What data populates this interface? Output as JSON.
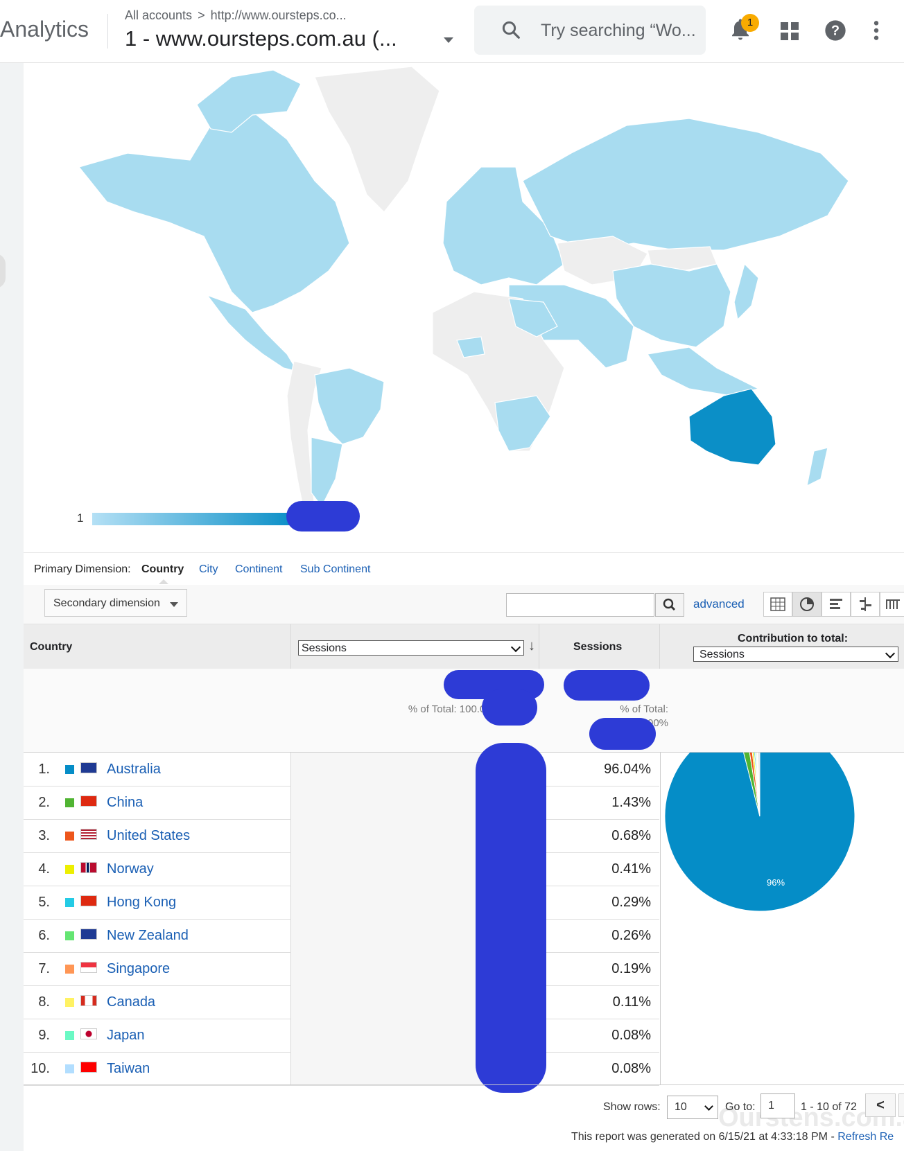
{
  "header": {
    "app_name": "Analytics",
    "breadcrumb": {
      "all_accounts": "All accounts",
      "separator": ">",
      "property": "http://www.oursteps.co..."
    },
    "view_title": "1 - www.oursteps.com.au (...",
    "search_placeholder": "Try searching “Wo...",
    "notifications_count": "1"
  },
  "map": {
    "legend_min": "1",
    "highlight_color": "#0b8fc7",
    "light_color": "#a8dcf0",
    "nodata_color": "#eeeeee"
  },
  "dimensions": {
    "label": "Primary Dimension:",
    "active": "Country",
    "links": [
      "City",
      "Continent",
      "Sub Continent"
    ]
  },
  "toolbar": {
    "secondary_dimension": "Secondary dimension",
    "advanced": "advanced"
  },
  "table": {
    "col_country": "Country",
    "metric_select": "Sessions",
    "col_sessions": "Sessions",
    "contribution_label": "Contribution to total:",
    "contribution_select": "Sessions",
    "total_pct_left": "% of Total: 100.00%",
    "total_pct_right_1": "% of Total:",
    "total_pct_right_2": "100.00%",
    "rows": [
      {
        "rank": "1.",
        "country": "Australia",
        "pct": "96.04%",
        "color": "#058dc7"
      },
      {
        "rank": "2.",
        "country": "China",
        "pct": "1.43%",
        "color": "#50b432"
      },
      {
        "rank": "3.",
        "country": "United States",
        "pct": "0.68%",
        "color": "#ed561b"
      },
      {
        "rank": "4.",
        "country": "Norway",
        "pct": "0.41%",
        "color": "#edef00"
      },
      {
        "rank": "5.",
        "country": "Hong Kong",
        "pct": "0.29%",
        "color": "#24cbe5"
      },
      {
        "rank": "6.",
        "country": "New Zealand",
        "pct": "0.26%",
        "color": "#64e572"
      },
      {
        "rank": "7.",
        "country": "Singapore",
        "pct": "0.19%",
        "color": "#ff9655"
      },
      {
        "rank": "8.",
        "country": "Canada",
        "pct": "0.11%",
        "color": "#fff263"
      },
      {
        "rank": "9.",
        "country": "Japan",
        "pct": "0.08%",
        "color": "#6af9c4"
      },
      {
        "rank": "10.",
        "country": "Taiwan",
        "pct": "0.08%",
        "color": "#b2deff"
      }
    ]
  },
  "pie": {
    "label": "96%"
  },
  "footer": {
    "show_rows_label": "Show rows:",
    "show_rows_value": "10",
    "goto_label": "Go to:",
    "goto_value": "1",
    "range": "1 - 10 of 72",
    "prev": "<",
    "generated_prefix": "This report was generated on 6/15/21 at 4:33:18 PM -",
    "refresh": "Refresh Re",
    "watermark": "Ourstens.com.au"
  }
}
